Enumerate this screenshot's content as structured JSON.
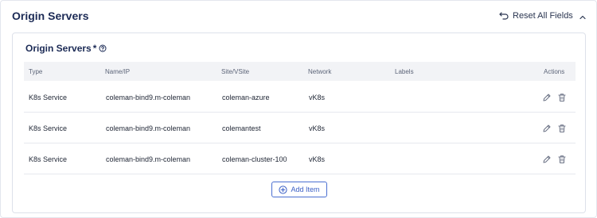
{
  "section": {
    "title": "Origin Servers",
    "reset_label": "Reset All Fields"
  },
  "card": {
    "title": "Origin Servers",
    "required_mark": "*"
  },
  "table": {
    "headers": {
      "type": "Type",
      "name": "Name/IP",
      "site": "Site/VSite",
      "network": "Network",
      "labels": "Labels",
      "actions": "Actions"
    },
    "rows": [
      {
        "type": "K8s Service",
        "name": "coleman-bind9.m-coleman",
        "site": "coleman-azure",
        "network": "vK8s",
        "labels": ""
      },
      {
        "type": "K8s Service",
        "name": "coleman-bind9.m-coleman",
        "site": "colemantest",
        "network": "vK8s",
        "labels": ""
      },
      {
        "type": "K8s Service",
        "name": "coleman-bind9.m-coleman",
        "site": "coleman-cluster-100",
        "network": "vK8s",
        "labels": ""
      }
    ]
  },
  "add_item_label": "Add Item",
  "icons": {
    "reset": "undo-arrow-icon",
    "collapse": "chevron-up-icon",
    "help": "question-circle-icon",
    "edit": "pencil-icon",
    "delete": "trash-icon",
    "add": "plus-circle-icon"
  },
  "colors": {
    "title": "#1b2a55",
    "accent": "#3a5fc6",
    "header_bg": "#f2f3f6",
    "icon": "#6b7285"
  }
}
